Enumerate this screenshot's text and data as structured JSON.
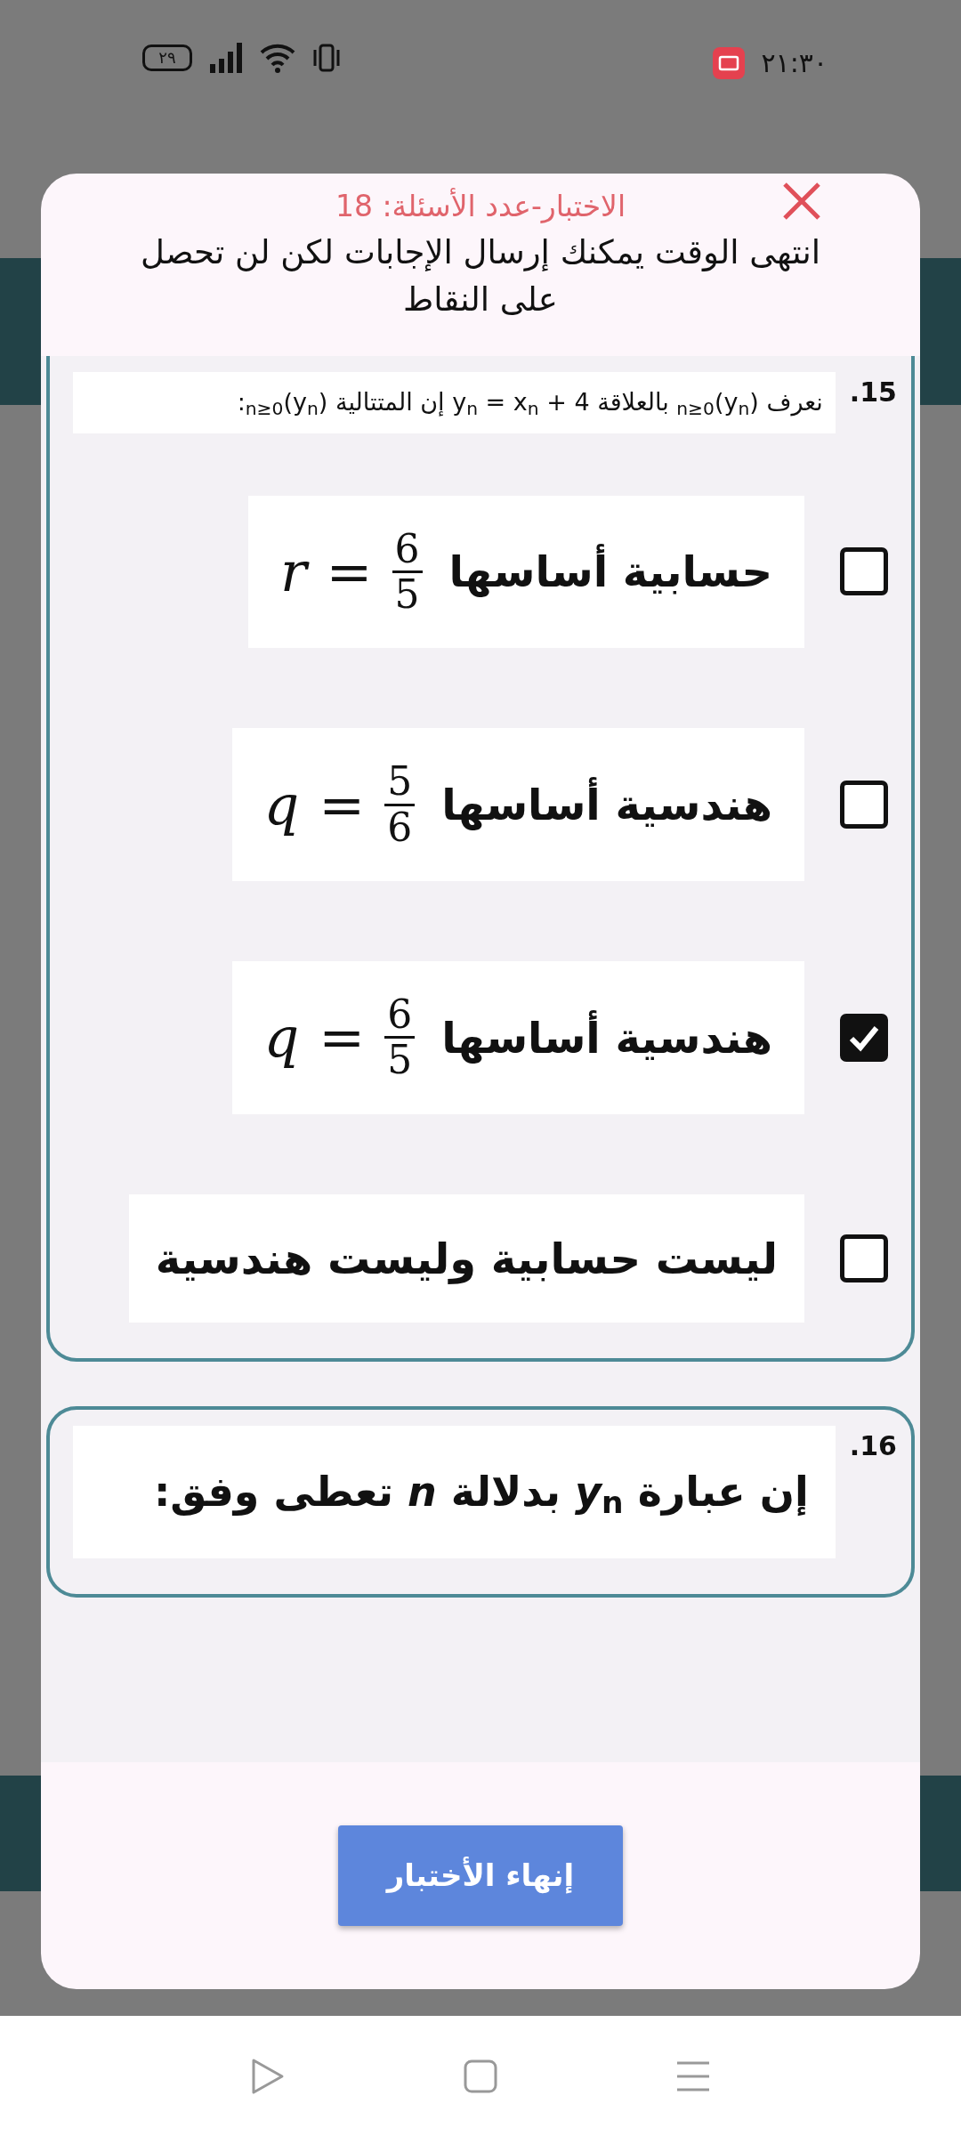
{
  "status_bar": {
    "time": "٢١:٣٠",
    "battery": "٢٩"
  },
  "dialog": {
    "title": "الاختبار-عدد الأسئلة: 18",
    "message": "انتهى الوقت يمكنك إرسال الإجابات لكن لن تحصل على النقاط",
    "questions": [
      {
        "number": ".15",
        "text": "نعرف (y$_{n}$)$_{n≥0}$ بالعلاقة y$_{n}$ = x$_{n}$ + 4 إن المتتالية (y$_{n}$)$_{n≥0}$:",
        "options": [
          {
            "kind": "fraction",
            "text": "حسابية أساسها",
            "variable": "r",
            "relation": "=",
            "numerator": "6",
            "denominator": "5",
            "checked": false
          },
          {
            "kind": "fraction",
            "text": "هندسية أساسها",
            "variable": "q",
            "relation": "=",
            "numerator": "5",
            "denominator": "6",
            "checked": false
          },
          {
            "kind": "fraction",
            "text": "هندسية أساسها",
            "variable": "q",
            "relation": "=",
            "numerator": "6",
            "denominator": "5",
            "checked": true
          },
          {
            "kind": "text",
            "text": "ليست حسابية وليست هندسية",
            "checked": false
          }
        ]
      },
      {
        "number": ".16",
        "text": "إن عبارة *y*$_{n}$ بدلالة *n* تعطى وفق:"
      }
    ],
    "finish_button": "إنهاء الأختبار"
  }
}
